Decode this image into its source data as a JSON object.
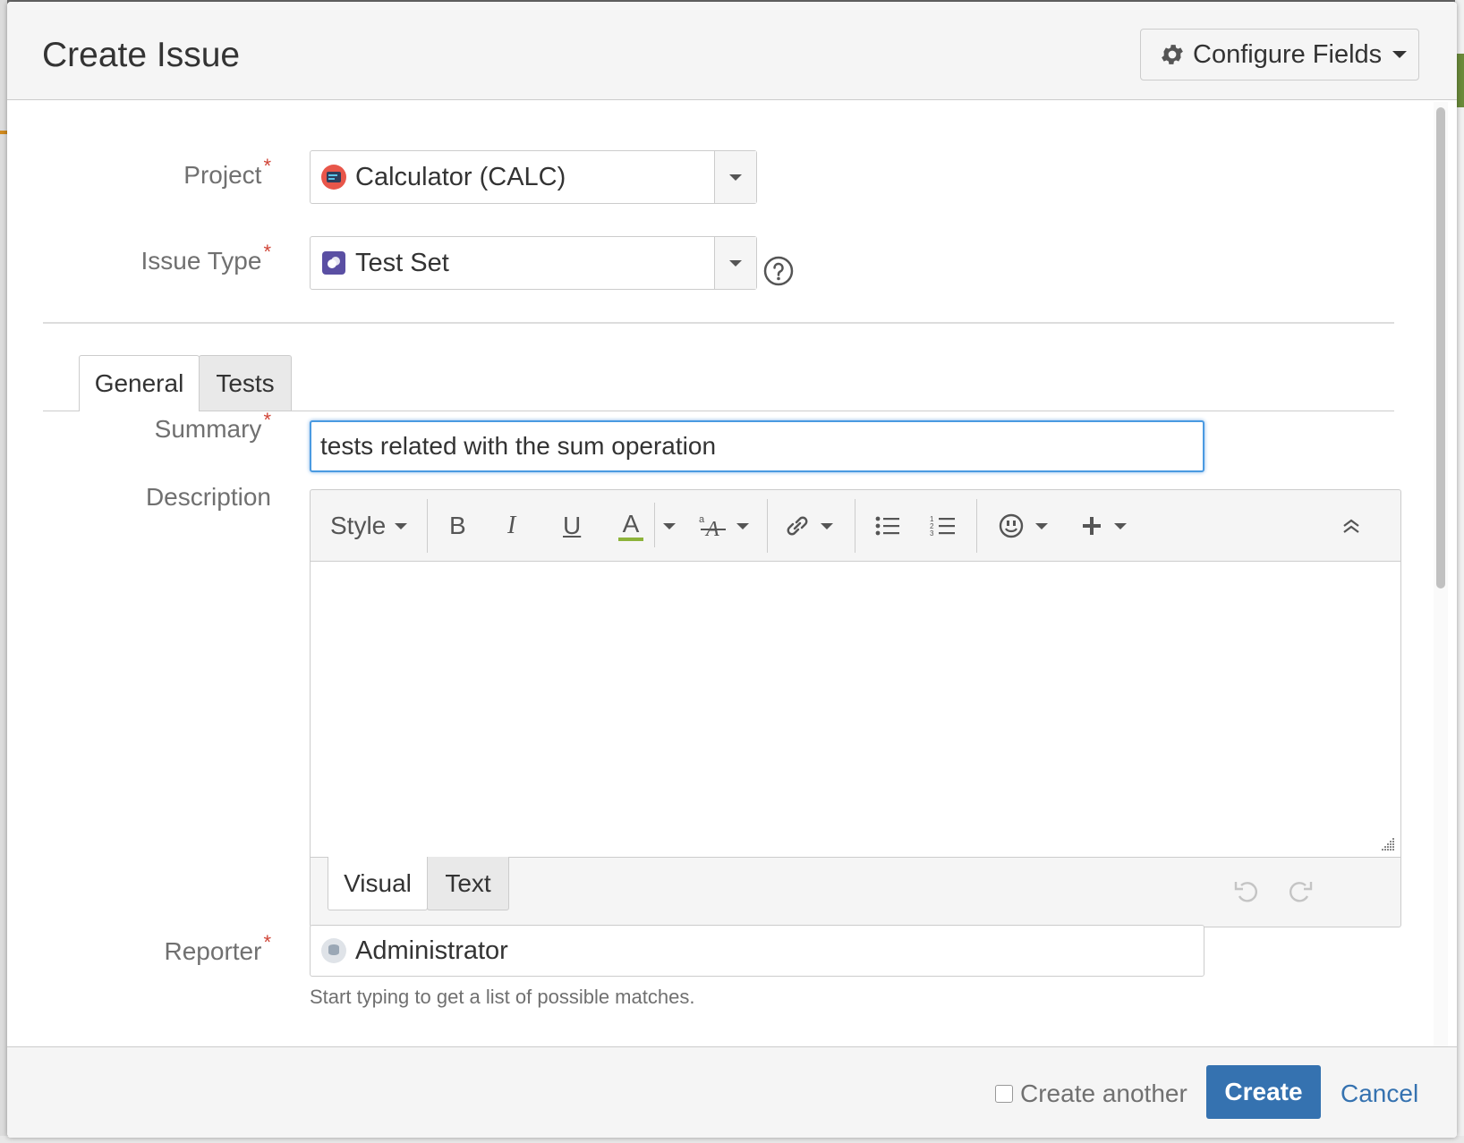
{
  "dialog": {
    "title": "Create Issue",
    "configure_label": "Configure Fields"
  },
  "fields": {
    "project": {
      "label": "Project",
      "value": "Calculator (CALC)"
    },
    "issue_type": {
      "label": "Issue Type",
      "value": "Test Set"
    },
    "summary": {
      "label": "Summary",
      "value": "tests related with the sum operation"
    },
    "description": {
      "label": "Description"
    },
    "reporter": {
      "label": "Reporter",
      "value": "Administrator",
      "hint": "Start typing to get a list of possible matches."
    }
  },
  "required_marker": "*",
  "tabs": [
    {
      "label": "General",
      "active": true
    },
    {
      "label": "Tests",
      "active": false
    }
  ],
  "editor": {
    "style_label": "Style",
    "bold_label": "B",
    "italic_label": "I",
    "underline_label": "U",
    "color_label": "A",
    "modes": [
      {
        "label": "Visual",
        "active": true
      },
      {
        "label": "Text",
        "active": false
      }
    ]
  },
  "footer": {
    "create_another_label": "Create another",
    "create_label": "Create",
    "cancel_label": "Cancel"
  },
  "icons": {
    "configure": "gear-icon",
    "help": "question-circle-icon",
    "project": "project-avatar-icon",
    "issue_type": "test-set-icon",
    "undo": "undo-icon",
    "redo": "redo-icon"
  },
  "colors": {
    "primary": "#3572b0",
    "required": "#d04437",
    "focus": "#4a9ae1",
    "text_color_underline": "#8db33a"
  }
}
